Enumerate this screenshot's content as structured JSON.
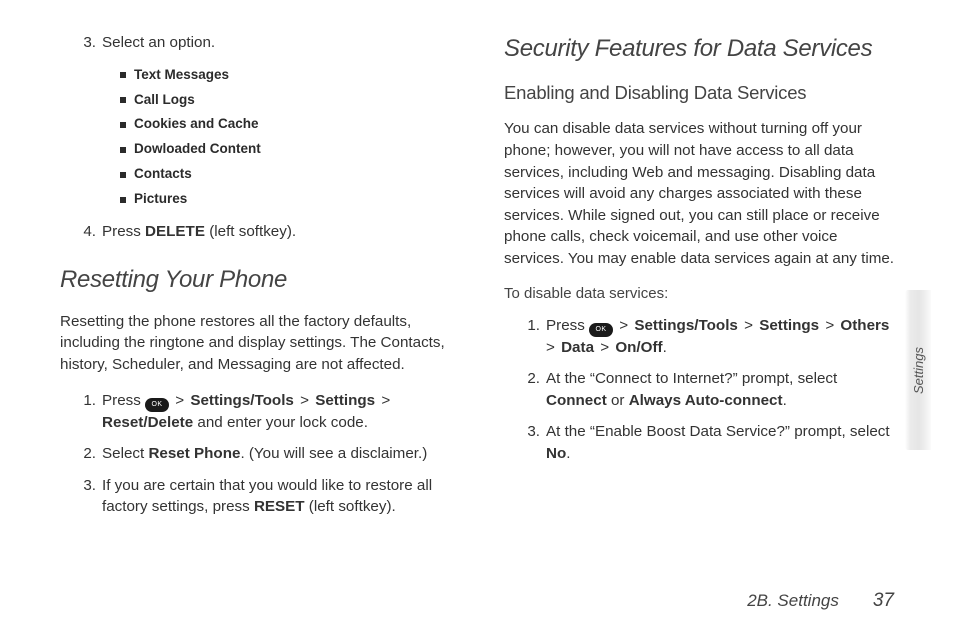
{
  "sideTab": "Settings",
  "footer": {
    "section": "2B. Settings",
    "page": "37"
  },
  "left": {
    "step3": {
      "num": "3.",
      "text": "Select an option."
    },
    "options": [
      "Text Messages",
      "Call Logs",
      "Cookies and Cache",
      "Dowloaded Content",
      "Contacts",
      "Pictures"
    ],
    "step4": {
      "num": "4.",
      "pre": "Press ",
      "bold": "DELETE",
      "post": " (left softkey)."
    },
    "h2": "Resetting Your Phone",
    "para": "Resetting the phone restores all the factory defaults, including the ringtone and display settings. The Contacts, history, Scheduler, and Messaging are not affected.",
    "r1": {
      "num": "1.",
      "pre": "Press ",
      "ok": "OK",
      "gt1": " > ",
      "b1": "Settings/Tools",
      "gt2": " > ",
      "b2": "Settings",
      "gt3": " > ",
      "b3": "Reset/Delete",
      "post": " and enter your lock code."
    },
    "r2": {
      "num": "2.",
      "pre": "Select ",
      "b": "Reset Phone",
      "post": ". (You will see a disclaimer.)"
    },
    "r3": {
      "num": "3.",
      "pre": "If you are certain that you would like to restore all factory settings, press ",
      "b": "RESET",
      "post": " (left softkey)."
    }
  },
  "right": {
    "h2": "Security Features for Data Services",
    "h3": "Enabling and Disabling Data Services",
    "para": "You can disable data services without turning off your phone; however, you will not have access to all data services, including Web and messaging. Disabling data services will avoid any charges associated with these services. While signed out, you can still place or receive phone calls, check voicemail, and use other voice services. You may enable data services again at any time.",
    "lead": "To disable data services:",
    "d1": {
      "num": "1.",
      "pre": "Press ",
      "ok": "OK",
      "gt1": " > ",
      "b1": "Settings/Tools",
      "gt2": " > ",
      "b2": "Settings",
      "gt3": " > ",
      "b3": "Others",
      "gt4": " > ",
      "b4": "Data",
      "gt5": " > ",
      "b5": "On/Off",
      "post": "."
    },
    "d2": {
      "num": "2.",
      "pre": "At the “Connect to Internet?” prompt, select ",
      "b1": "Connect",
      "mid": " or ",
      "b2": "Always Auto-connect",
      "post": "."
    },
    "d3": {
      "num": "3.",
      "pre": "At the “Enable Boost Data Service?” prompt, select ",
      "b": "No",
      "post": "."
    }
  }
}
